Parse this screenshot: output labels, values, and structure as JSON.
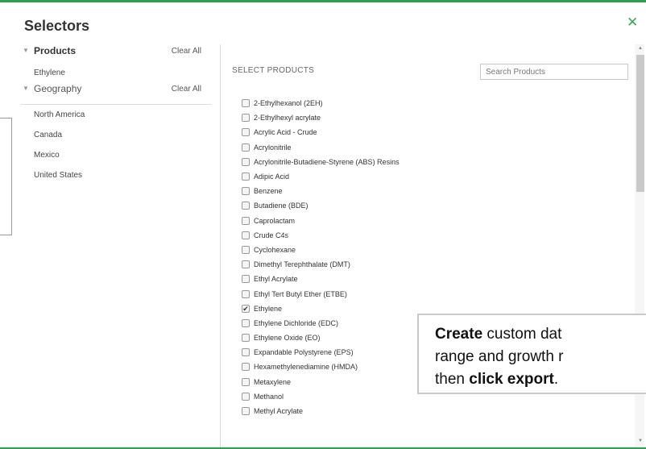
{
  "title": "Selectors",
  "left": {
    "products": {
      "label": "Products",
      "clear": "Clear All",
      "items": [
        "Ethylene"
      ]
    },
    "geography": {
      "label": "Geography",
      "clear": "Clear All",
      "items": [
        "North America",
        "Canada",
        "Mexico",
        "United States"
      ]
    }
  },
  "products_panel": {
    "heading": "SELECT PRODUCTS",
    "search_placeholder": "Search Products",
    "items": [
      {
        "label": "2-Ethylhexanol (2EH)",
        "checked": false
      },
      {
        "label": "2-Ethylhexyl acrylate",
        "checked": false
      },
      {
        "label": "Acrylic Acid - Crude",
        "checked": false
      },
      {
        "label": "Acrylonitrile",
        "checked": false
      },
      {
        "label": "Acrylonitrile-Butadiene-Styrene (ABS) Resins",
        "checked": false
      },
      {
        "label": "Adipic Acid",
        "checked": false
      },
      {
        "label": "Benzene",
        "checked": false
      },
      {
        "label": "Butadiene (BDE)",
        "checked": false
      },
      {
        "label": "Caprolactam",
        "checked": false
      },
      {
        "label": "Crude C4s",
        "checked": false
      },
      {
        "label": "Cyclohexane",
        "checked": false
      },
      {
        "label": "Dimethyl Terephthalate (DMT)",
        "checked": false
      },
      {
        "label": "Ethyl Acrylate",
        "checked": false
      },
      {
        "label": "Ethyl Tert Butyl Ether (ETBE)",
        "checked": false
      },
      {
        "label": "Ethylene",
        "checked": true
      },
      {
        "label": "Ethylene Dichloride (EDC)",
        "checked": false
      },
      {
        "label": "Ethylene Oxide (EO)",
        "checked": false
      },
      {
        "label": "Expandable Polystyrene (EPS)",
        "checked": false
      },
      {
        "label": "Hexamethylenediamine (HMDA)",
        "checked": false
      },
      {
        "label": "Metaxylene",
        "checked": false
      },
      {
        "label": "Methanol",
        "checked": false
      },
      {
        "label": "Methyl Acrylate",
        "checked": false
      }
    ]
  },
  "callout": {
    "part1_bold": "Create",
    "part2": " custom dat",
    "line2": "range and growth r",
    "line3_pre": "then ",
    "line3_bold": "click export",
    "line3_post": "."
  },
  "icons": {
    "close": "close-icon",
    "collapse": "chevron-down-icon",
    "check": "checkmark-icon"
  },
  "colors": {
    "accent": "#2e9e4f"
  }
}
